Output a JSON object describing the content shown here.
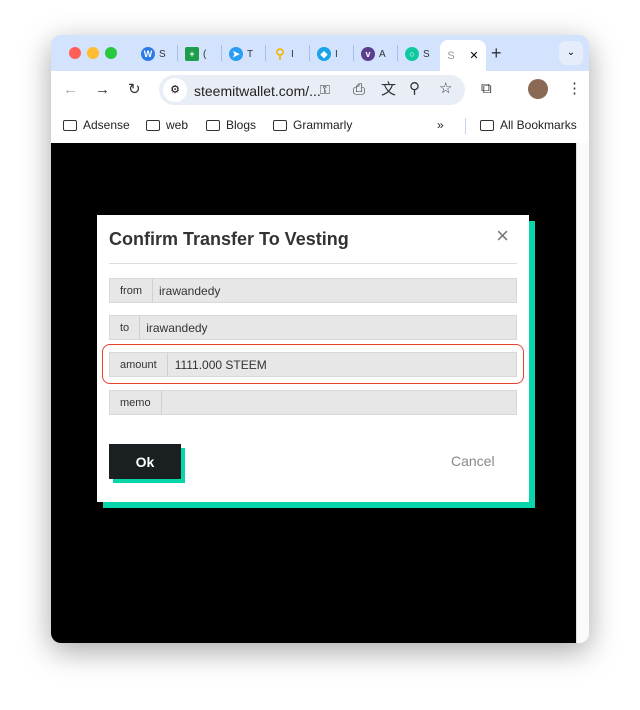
{
  "browser": {
    "tabs": [
      {
        "icon": "steemit-icon",
        "color": "#2c7be5",
        "label": "S"
      },
      {
        "icon": "plus-sheet-icon",
        "color": "#1e9e4a",
        "label": "("
      },
      {
        "icon": "telegram-icon",
        "color": "#2a9df4",
        "label": "T"
      },
      {
        "icon": "search-magnifier-icon",
        "color": "#f2b600",
        "label": "I"
      },
      {
        "icon": "gem-icon",
        "color": "#1aa3e8",
        "label": "I"
      },
      {
        "icon": "v-icon",
        "color": "#5b3f8c",
        "label": "A"
      },
      {
        "icon": "chat-bubble-icon",
        "color": "#10c9a0",
        "label": "S"
      }
    ],
    "active_tab": {
      "label": "S"
    },
    "url": "steemitwallet.com/...",
    "bookmarks": [
      "Adsense",
      "web",
      "Blogs",
      "Grammarly"
    ],
    "all_bookmarks": "All Bookmarks"
  },
  "dialog": {
    "title": "Confirm Transfer To Vesting",
    "fields": [
      {
        "label": "from",
        "value": "irawandedy"
      },
      {
        "label": "to",
        "value": "irawandedy"
      },
      {
        "label": "amount",
        "value": "1111.000 STEEM"
      },
      {
        "label": "memo",
        "value": ""
      }
    ],
    "ok": "Ok",
    "cancel": "Cancel"
  },
  "colors": {
    "accent": "#06d6a9",
    "highlight": "#e8402a",
    "button": "#1a1f22"
  }
}
